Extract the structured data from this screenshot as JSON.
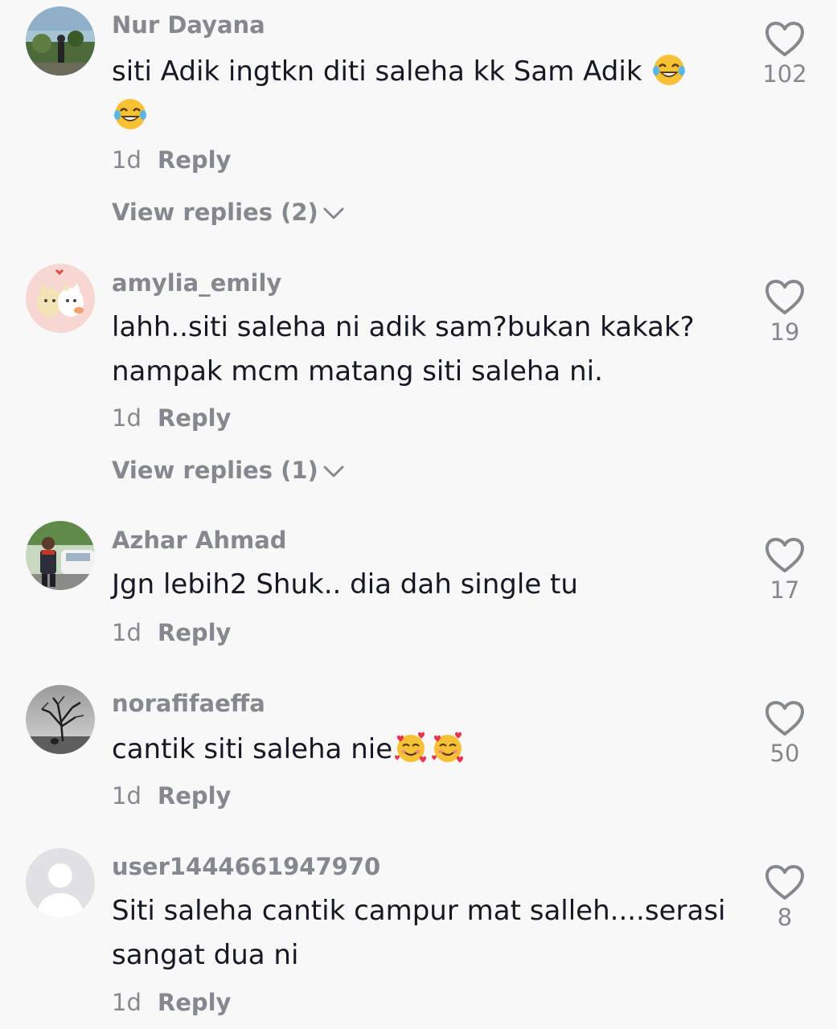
{
  "comments": [
    {
      "username": "Nur Dayana",
      "text": "siti Adik ingtkn diti saleha kk Sam Adik",
      "emoji": [
        "face-with-tears-of-joy",
        "face-with-tears-of-joy"
      ],
      "time": "1d",
      "reply_label": "Reply",
      "view_replies": "View replies (2)",
      "likes": "102",
      "avatar": "photo-person-outdoors"
    },
    {
      "username": "amylia_emily",
      "text": "lahh..siti saleha ni adik sam?bukan kakak? nampak mcm matang siti saleha ni.",
      "time": "1d",
      "reply_label": "Reply",
      "view_replies": "View replies (1)",
      "likes": "19",
      "avatar": "cartoon-cats"
    },
    {
      "username": "Azhar Ahmad",
      "text": "Jgn lebih2 Shuk.. dia dah single tu",
      "time": "1d",
      "reply_label": "Reply",
      "likes": "17",
      "avatar": "photo-man-with-car"
    },
    {
      "username": "norafifaeffa",
      "text": "cantik siti saleha nie",
      "emoji": [
        "smiling-face-with-hearts",
        "smiling-face-with-hearts"
      ],
      "time": "1d",
      "reply_label": "Reply",
      "likes": "50",
      "avatar": "photo-tree-storm"
    },
    {
      "username": "user1444661947970",
      "text": "Siti saleha cantik campur mat salleh....serasi sangat dua ni",
      "time": "1d",
      "reply_label": "Reply",
      "likes": "8",
      "avatar": "default-user"
    }
  ],
  "colors": {
    "background": "#f8f8f8",
    "text_primary": "#161823",
    "text_secondary": "#868890",
    "icon": "#868890"
  },
  "icons": {
    "like": "heart-outline-icon",
    "expand": "chevron-down-icon"
  }
}
